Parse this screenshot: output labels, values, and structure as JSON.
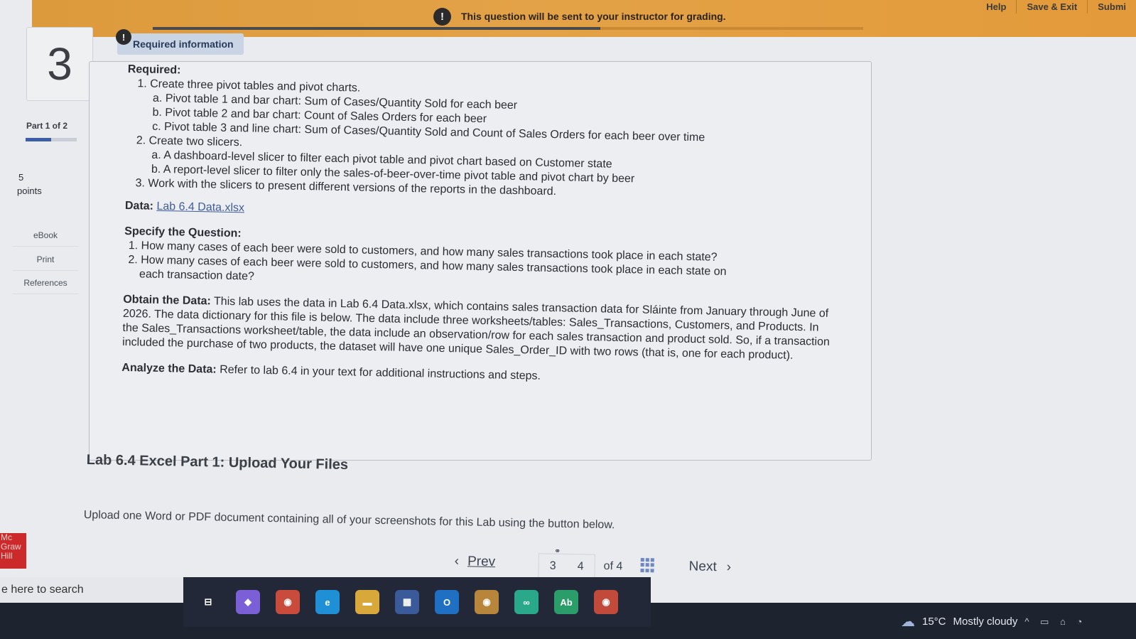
{
  "top_banner": {
    "notice": "This question will be sent to your instructor for grading.",
    "alert_glyph": "!",
    "links": [
      "Help",
      "Save & Exit",
      "Submi"
    ]
  },
  "sidebar": {
    "question_number": "3",
    "part_label": "Part 1 of 2",
    "part_progress": 0.5,
    "points_value": "5",
    "points_label": "points",
    "buttons": [
      "eBook",
      "Print",
      "References"
    ],
    "logo_text": "Mc Graw Hill"
  },
  "required_info": {
    "tab_label": "Required information",
    "tab_glyph": "!",
    "required_heading": "Required:",
    "items": [
      "1. Create three pivot tables and pivot charts.",
      "a. Pivot table 1 and bar chart: Sum of Cases/Quantity Sold for each beer",
      "b. Pivot table 2 and bar chart: Count of Sales Orders for each beer",
      "c. Pivot table 3 and line chart: Sum of Cases/Quantity Sold and Count of Sales Orders for each beer over time",
      "2. Create two slicers.",
      "a. A dashboard-level slicer to filter each pivot table and pivot chart based on Customer state",
      "b. A report-level slicer to filter only the sales-of-beer-over-time pivot table and pivot chart by beer",
      "3. Work with the slicers to present different versions of the reports in the dashboard."
    ],
    "data_label": "Data:",
    "data_link": "Lab 6.4 Data.xlsx",
    "question_heading": "Specify the Question:",
    "question_1": "1. How many cases of each beer were sold to customers, and how many sales transactions took place in each state?",
    "question_2a": "2. How many cases of each beer were sold to customers, and how many sales transactions took place in each state on",
    "question_2b": "each transaction date?",
    "obtain_label": "Obtain the Data:",
    "obtain_text": "This lab uses the data in Lab 6.4 Data.xlsx, which contains sales transaction data for Sláinte from January through June of 2026. The data dictionary for this file is below. The data include three worksheets/tables: Sales_Transactions, Customers, and Products. In the Sales_Transactions worksheet/table, the data include an observation/row for each sales transaction and product sold. So, if a transaction included the purchase of two products, the dataset will have one unique Sales_Order_ID with two rows (that is, one for each product).",
    "analyze_label": "Analyze the Data:",
    "analyze_text": "Refer to lab 6.4 in your text for additional instructions and steps."
  },
  "main": {
    "lab_title": "Lab 6.4 Excel Part 1: Upload Your Files",
    "upload_text": "Upload one Word or PDF document containing all of your screenshots for this Lab using the button below."
  },
  "pager": {
    "prev_label": "Prev",
    "page_a": "3",
    "page_b": "4",
    "of_label": "of 4",
    "next_label": "Next"
  },
  "taskbar": {
    "search_text": "e here to search",
    "apps": [
      {
        "icon": "task-view-icon",
        "glyph": "⊟",
        "color": "#232838"
      },
      {
        "icon": "copilot-icon",
        "glyph": "◆",
        "color": "#7a5fd6"
      },
      {
        "icon": "chrome-icon",
        "glyph": "◉",
        "color": "#c94b3b"
      },
      {
        "icon": "edge-icon",
        "glyph": "e",
        "color": "#1f8fd6"
      },
      {
        "icon": "file-explorer-icon",
        "glyph": "▬",
        "color": "#d9a83b"
      },
      {
        "icon": "store-icon",
        "glyph": "▦",
        "color": "#3a5a9a"
      },
      {
        "icon": "outlook-icon",
        "glyph": "O",
        "color": "#1f6fc2"
      },
      {
        "icon": "chrome-profile-icon",
        "glyph": "◉",
        "color": "#b8863b"
      },
      {
        "icon": "infinity-app-icon",
        "glyph": "∞",
        "color": "#2aa98a"
      },
      {
        "icon": "abby-app-icon",
        "glyph": "Ab",
        "color": "#2a9d6a"
      },
      {
        "icon": "chrome-m-icon",
        "glyph": "◉",
        "color": "#c14a3b"
      }
    ],
    "temperature": "15°C",
    "weather": "Mostly cloudy",
    "tray_glyphs": "^ ▭ ⌂ ◔"
  }
}
